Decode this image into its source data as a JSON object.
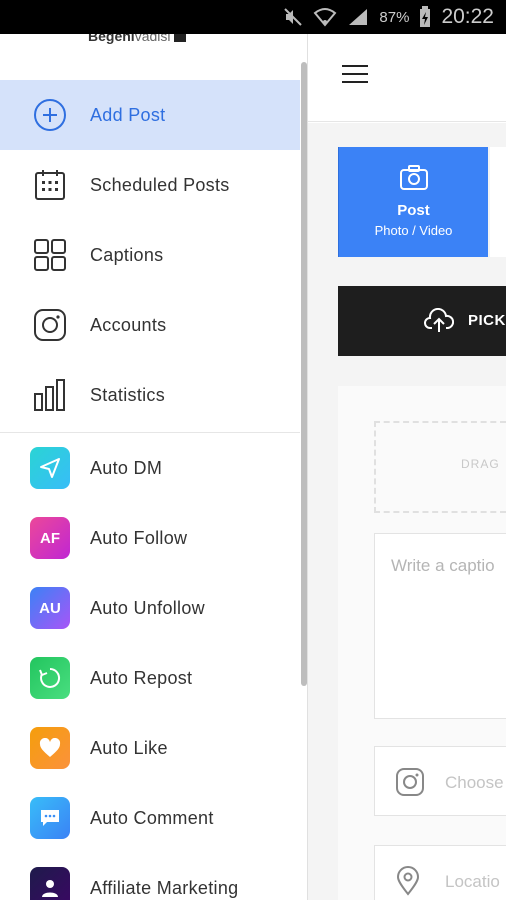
{
  "status_bar": {
    "battery_percent": "87%",
    "time": "20:22"
  },
  "drawer": {
    "user": {
      "name": "Begeni",
      "sub": "vadisi"
    },
    "primary_items": [
      {
        "label": "Add Post",
        "icon": "add-circle-icon",
        "active": true
      },
      {
        "label": "Scheduled Posts",
        "icon": "calendar-icon",
        "active": false
      },
      {
        "label": "Captions",
        "icon": "grid-icon",
        "active": false
      },
      {
        "label": "Accounts",
        "icon": "instagram-icon",
        "active": false
      },
      {
        "label": "Statistics",
        "icon": "bar-chart-icon",
        "active": false
      }
    ],
    "tool_items": [
      {
        "label": "Auto DM",
        "icon": "send-icon",
        "colors": [
          "#2ad4d4",
          "#38bdf8"
        ]
      },
      {
        "label": "Auto Follow",
        "icon_text": "AF",
        "colors": [
          "#ec4899",
          "#c026d3"
        ]
      },
      {
        "label": "Auto Unfollow",
        "icon_text": "AU",
        "colors": [
          "#3b82f6",
          "#a855f7"
        ]
      },
      {
        "label": "Auto Repost",
        "icon": "repost-icon",
        "colors": [
          "#22c55e",
          "#4ade80"
        ]
      },
      {
        "label": "Auto Like",
        "icon": "heart-icon",
        "colors": [
          "#f59e0b",
          "#fb923c"
        ]
      },
      {
        "label": "Auto Comment",
        "icon": "comment-icon",
        "colors": [
          "#38bdf8",
          "#3b82f6"
        ]
      },
      {
        "label": "Affiliate Marketing",
        "icon": "person-icon",
        "colors": [
          "#1e1b4b",
          "#3b0764"
        ]
      }
    ],
    "accent_color": "#2f6fe0",
    "active_bg": "#d5e2fa"
  },
  "main": {
    "post_tab": {
      "title": "Post",
      "subtitle": "Photo / Video",
      "color": "#3b82f6"
    },
    "pick_button": {
      "label": "PICK"
    },
    "drag_text": "DRAG",
    "caption_placeholder": "Write a captio",
    "account_placeholder": "Choose",
    "location_placeholder": "Locatio"
  }
}
